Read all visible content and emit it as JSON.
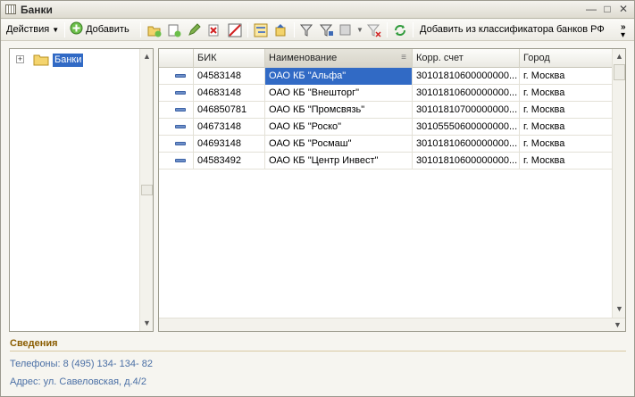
{
  "window": {
    "title": "Банки"
  },
  "toolbar": {
    "actions_label": "Действия",
    "add_label": "Добавить",
    "add_from_classifier_label": "Добавить из классификатора банков РФ"
  },
  "tree": {
    "items": [
      {
        "label": "Банки"
      }
    ]
  },
  "grid": {
    "columns": [
      "",
      "БИК",
      "Наименование",
      "Корр. счет",
      "Город"
    ],
    "rows": [
      {
        "bik": "04583148",
        "name": "ОАО КБ \"Альфа\"",
        "account": "30101810600000000...",
        "city": "г. Москва"
      },
      {
        "bik": "04683148",
        "name": "ОАО КБ \"Внешторг\"",
        "account": "30101810600000000...",
        "city": "г. Москва"
      },
      {
        "bik": "046850781",
        "name": "ОАО КБ \"Промсвязь\"",
        "account": "30101810700000000...",
        "city": "г. Москва"
      },
      {
        "bik": "04673148",
        "name": "ОАО КБ \"Роско\"",
        "account": "30105550600000000...",
        "city": "г. Москва"
      },
      {
        "bik": "04693148",
        "name": "ОАО КБ \"Росмаш\"",
        "account": "30101810600000000...",
        "city": "г. Москва"
      },
      {
        "bik": "04583492",
        "name": "ОАО КБ \"Центр Инвест\"",
        "account": "30101810600000000...",
        "city": "г. Москва"
      }
    ]
  },
  "info": {
    "title": "Сведения",
    "phones": "Телефоны: 8 (495) 134- 134- 82",
    "address": "Адрес: ул. Савеловская, д.4/2"
  },
  "colors": {
    "selection": "#316ac5",
    "info_title": "#8a5c00",
    "info_text": "#4a6fa5"
  }
}
